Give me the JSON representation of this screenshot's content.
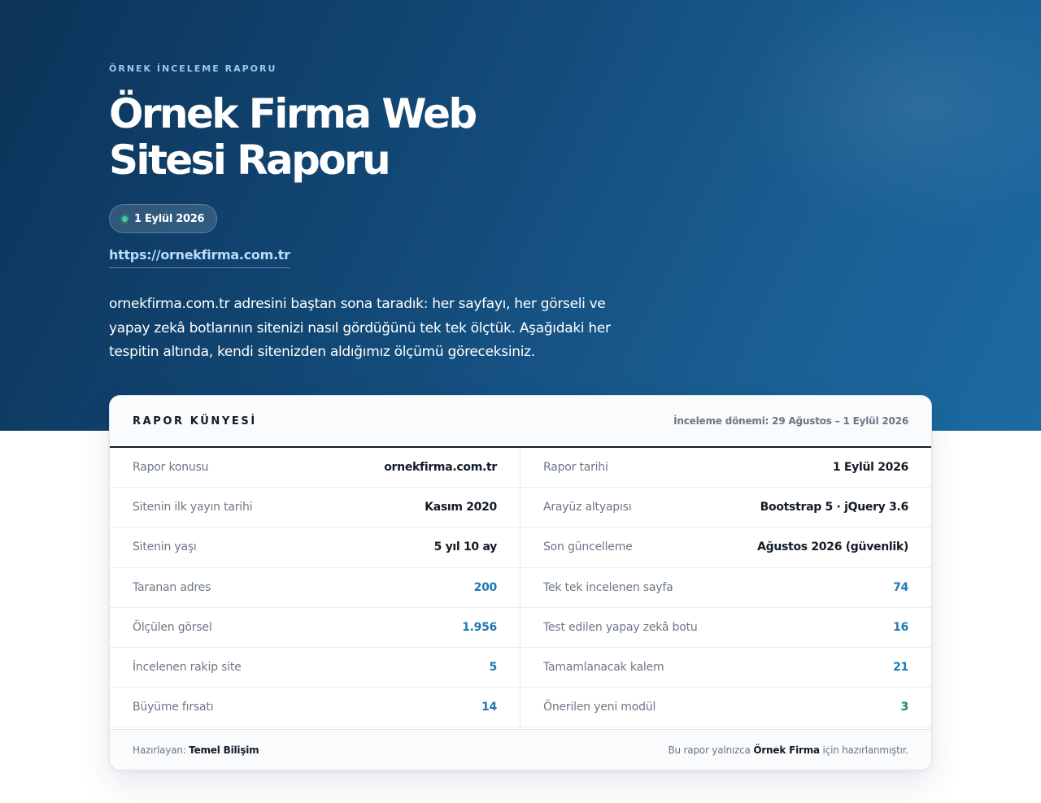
{
  "hero": {
    "eyebrow": "ÖRNEK İNCELEME RAPORU",
    "title": "Örnek Firma Web Sitesi Raporu",
    "date": "1 Eylül 2026",
    "url": "https://ornekfirma.com.tr",
    "intro": "ornekfirma.com.tr adresini baştan sona taradık: her sayfayı, her görseli ve yapay zekâ botlarının sitenizi nasıl gördüğünü tek tek ölçtük. Aşağıdaki her tespitin altında, kendi sitenizden aldığımız ölçümü göreceksiniz.",
    "status_dot_color": "#3ecf8e"
  },
  "card": {
    "title": "RAPOR KÜNYESİ",
    "period": "İnceleme dönemi: 29 Ağustos – 1 Eylül 2026",
    "rows": [
      {
        "left_label": "Rapor konusu",
        "left_value": "ornekfirma.com.tr",
        "right_label": "Rapor tarihi",
        "right_value": "1 Eylül 2026"
      },
      {
        "left_label": "Sitenin ilk yayın tarihi",
        "left_value": "Kasım 2020",
        "right_label": "Arayüz altyapısı",
        "right_value": "Bootstrap 5 · jQuery 3.6"
      },
      {
        "left_label": "Sitenin yaşı",
        "left_value": "5 yıl 10 ay",
        "right_label": "Son güncelleme",
        "right_value": "Ağustos 2026 (güvenlik)"
      },
      {
        "left_label": "Taranan adres",
        "left_value": "200",
        "right_label": "Tek tek incelenen sayfa",
        "right_value": "74"
      },
      {
        "left_label": "Ölçülen görsel",
        "left_value": "1.956",
        "right_label": "Test edilen yapay zekâ botu",
        "right_value": "16"
      },
      {
        "left_label": "İncelenen rakip site",
        "left_value": "5",
        "right_label": "Tamamlanacak kalem",
        "right_value": "21"
      },
      {
        "left_label": "Büyüme fırsatı",
        "left_value": "14",
        "right_label": "Önerilen yeni modül",
        "right_value": "3"
      }
    ],
    "footer": {
      "prepared_prefix": "Hazırlayan:",
      "prepared_by": "Temel Bilişim",
      "note_prefix": "Bu rapor yalnızca",
      "note_company": "Örnek Firma",
      "note_suffix": "için hazırlanmıştır."
    }
  }
}
